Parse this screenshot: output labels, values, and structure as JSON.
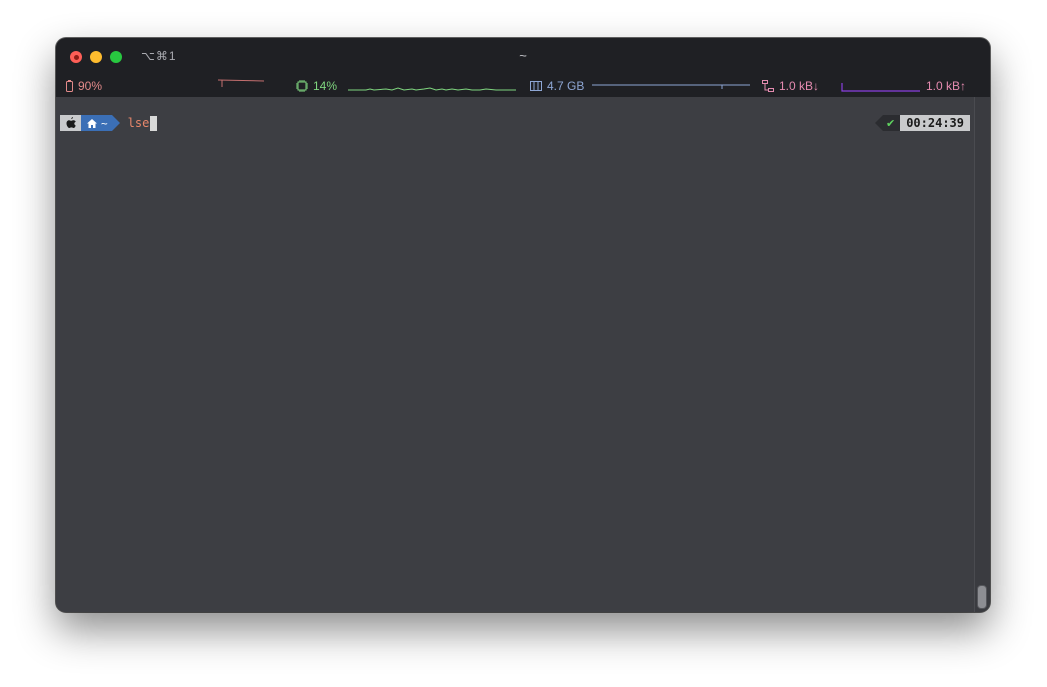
{
  "window": {
    "shortcut": "⌥⌘1",
    "title": "~"
  },
  "statusbar": {
    "battery": "90%",
    "cpu": "14%",
    "memory": "4.7 GB",
    "net_down": "1.0 kB↓",
    "net_up": "1.0 kB↑"
  },
  "prompt": {
    "dir": "~",
    "command": "lse"
  },
  "right_prompt": {
    "status": "✔",
    "time": "00:24:39"
  },
  "colors": {
    "battery": "#e38a8a",
    "cpu": "#7fd67f",
    "memory": "#8ea6d4",
    "network": "#e58bb0",
    "dir_segment": "#3b6fb6",
    "command": "#e8876b"
  }
}
